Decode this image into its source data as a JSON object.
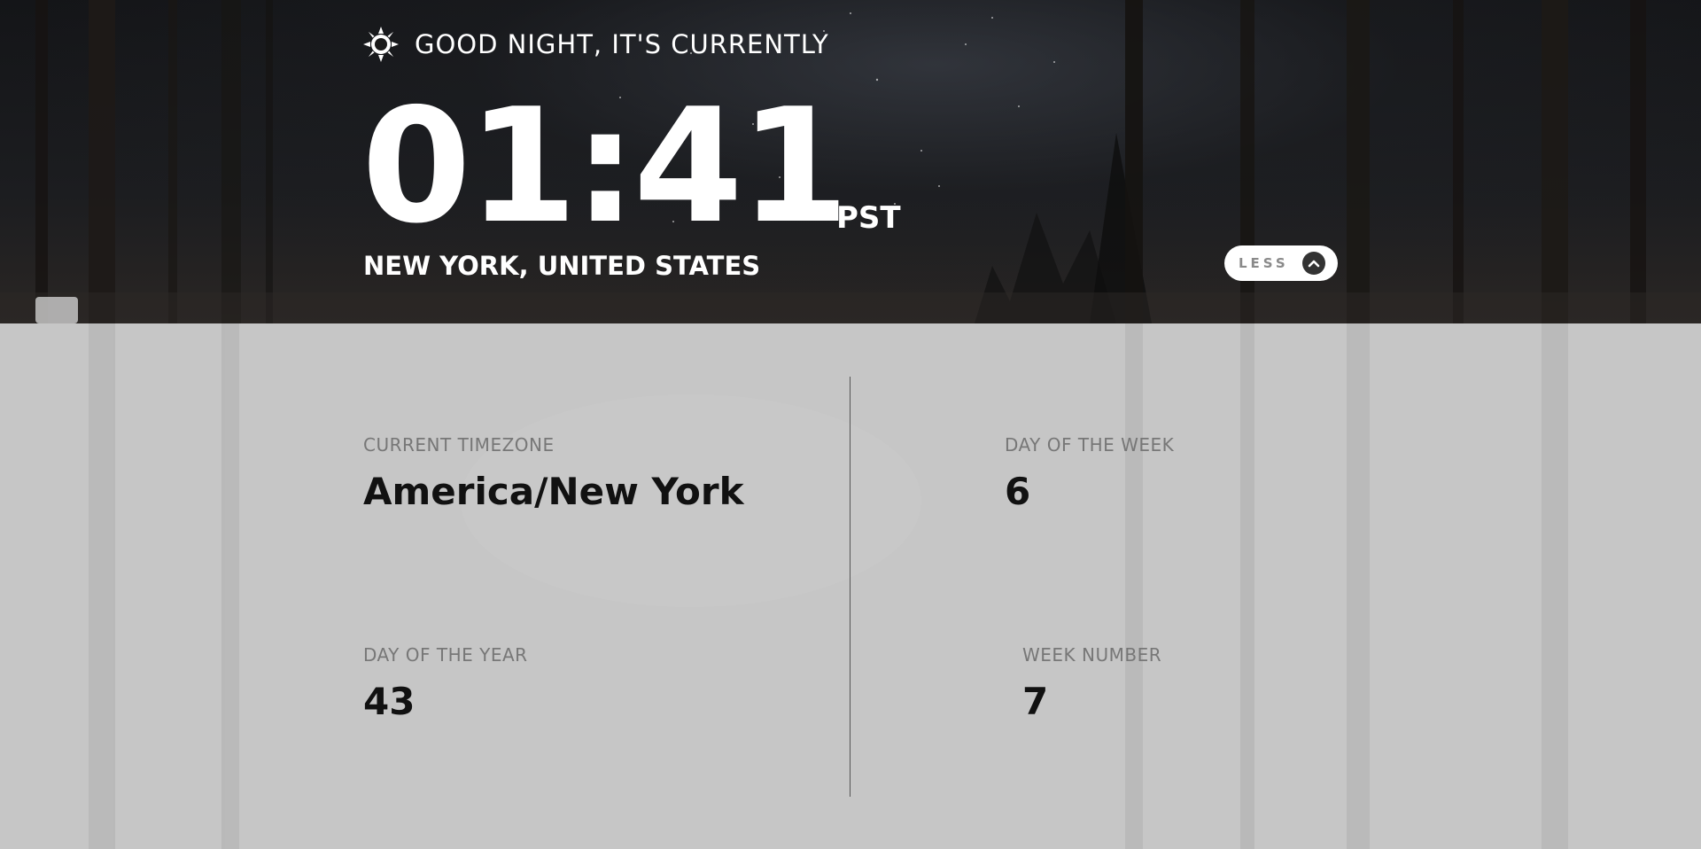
{
  "greeting": {
    "icon": "sun-icon",
    "text": "GOOD NIGHT, IT'S CURRENTLY"
  },
  "clock": {
    "time": "01:41",
    "abbreviation": "PST"
  },
  "location": "NEW YORK, UNITED STATES",
  "toggle": {
    "label": "LESS",
    "icon": "chevron-up-icon"
  },
  "details": {
    "timezone": {
      "label": "CURRENT TIMEZONE",
      "value": "America/New York"
    },
    "day_of_year": {
      "label": "DAY OF THE YEAR",
      "value": "43"
    },
    "day_of_week": {
      "label": "DAY OF THE WEEK",
      "value": "6"
    },
    "week_number": {
      "label": "WEEK NUMBER",
      "value": "7"
    }
  },
  "colors": {
    "hero_dark": "#141518",
    "panel_bg": "#c6c6c6",
    "label_gray": "#777777",
    "value_dark": "#111111"
  }
}
